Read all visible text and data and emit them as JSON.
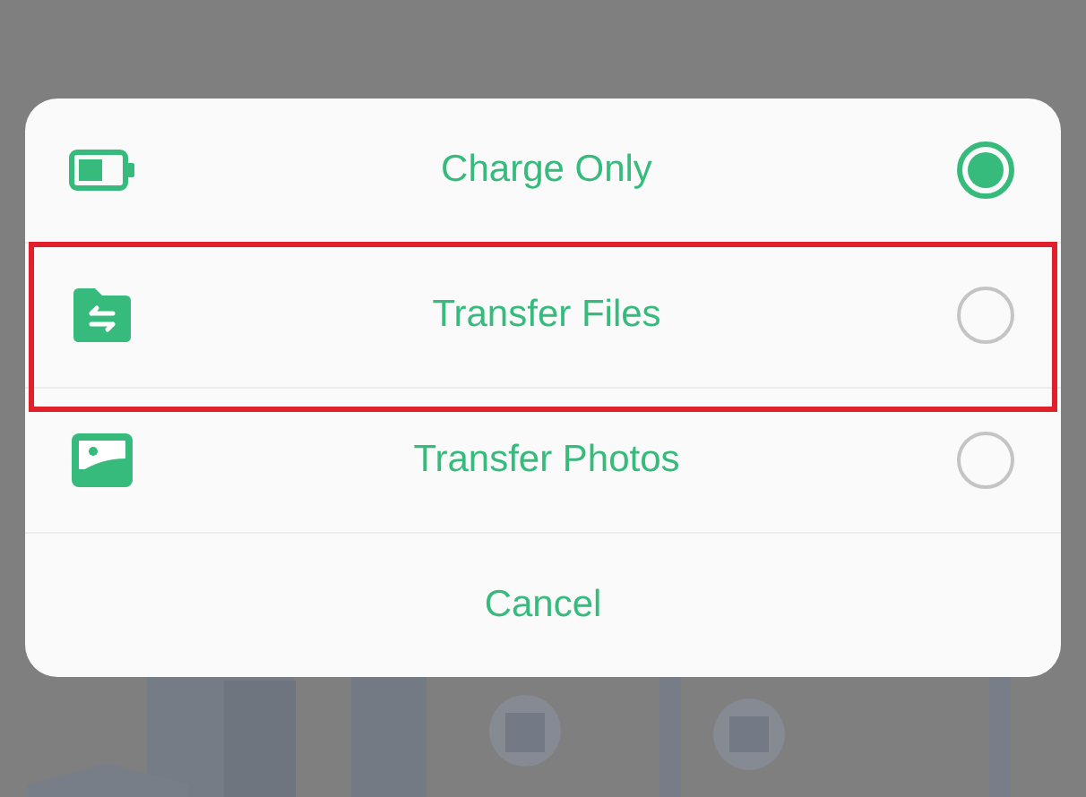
{
  "dialog": {
    "options": [
      {
        "kind": "battery",
        "label": "Charge Only",
        "selected": true,
        "highlighted": false
      },
      {
        "kind": "folder",
        "label": "Transfer Files",
        "selected": false,
        "highlighted": true
      },
      {
        "kind": "photo",
        "label": "Transfer Photos",
        "selected": false,
        "highlighted": false
      }
    ],
    "cancel": "Cancel"
  }
}
